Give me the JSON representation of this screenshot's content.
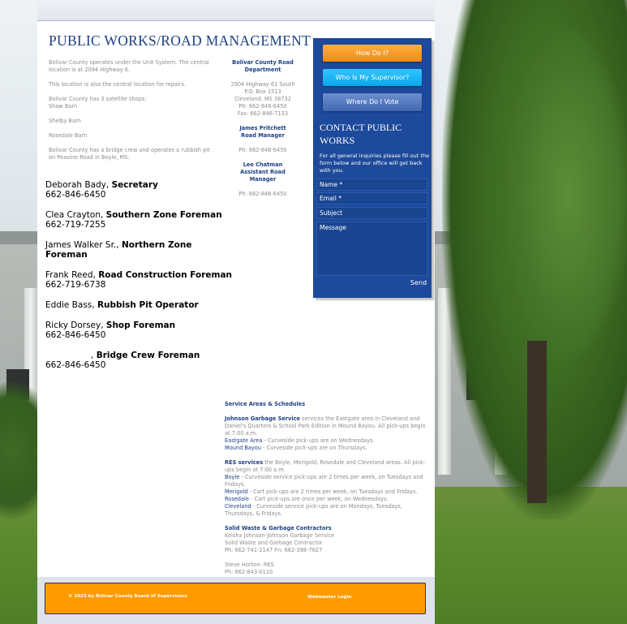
{
  "page": {
    "title": "PUBLIC WORKS/ROAD MANAGEMENT"
  },
  "intro": {
    "p1": "Bolivar County operates under the Unit System.  The central location is at 2094 Highway 6.",
    "p2": "This location is also the central location for repairs.",
    "p3a": "Bolivar County has 3 satellite shops:",
    "p3b": "Shaw Barn",
    "p4": "Shelby Barn",
    "p5": "Rosedale Barn",
    "p6": "Bolivar County has a bridge crew and operates a rubbish pit on Peavine Road in Boyle, MS."
  },
  "department": {
    "name_line1": "Bolivar County Road",
    "name_line2": "Department",
    "address1": "2904 Highway 61 South",
    "address2": "P.O. Box 1513",
    "address3": "Cleveland, MS  38732",
    "phone": "Ph:  662-846-6450",
    "fax": "Fax:  662-846-7133",
    "contacts": [
      {
        "name": "James Pritchett",
        "title": "Road Manager",
        "phone": "Ph:  662-846-6450"
      },
      {
        "name": "Lee Chatman",
        "title": "Assistant Road Manager",
        "phone": "Ph:  662-846-6450"
      }
    ]
  },
  "staff": [
    {
      "name": "Deborah Bady, ",
      "role": "Secretary",
      "phone": "662-846-6450"
    },
    {
      "name": "Clea Crayton, ",
      "role": "Southern Zone Foreman",
      "phone": "662-719-7255"
    },
    {
      "name": "James Walker Sr., ",
      "role": "Northern Zone Foreman",
      "phone": ""
    },
    {
      "name": "Frank Reed, ",
      "role": "Road Construction Foreman",
      "phone": "662-719-6738"
    },
    {
      "name": "Eddie Bass, ",
      "role": "Rubbish Pit Operator",
      "phone": ""
    },
    {
      "name": "Ricky Dorsey, ",
      "role": "Shop Foreman",
      "phone": "662-846-6450"
    },
    {
      "name": ", ",
      "role": "Bridge Crew Foreman",
      "phone": "662-846-6450"
    }
  ],
  "sidebar": {
    "btn_howdoi": "How Do I?",
    "btn_supervisor": "Who Is My Supervisor?",
    "btn_vote": "Where Do I Vote",
    "contact_title": "CONTACT PUBLIC WORKS",
    "contact_note": "For all general inquiries please fill out the form below and our office will get back with you.",
    "name_placeholder": "Name *",
    "email_placeholder": "Email *",
    "subject_placeholder": "Subject",
    "message_placeholder": "Message",
    "send_label": "Send"
  },
  "service": {
    "heading": "Service Areas & Schedules",
    "johnson_name": "Johnson Garbage Service",
    "johnson_text": " services the Eastgate area in Cleveland and Daniel's Quarters & School Park Edition in Mound Bayou. All pick-ups begin at 7:00 a.m.",
    "eastgate_label": "Eastgate Area",
    "eastgate_text": " - Curveside pick-ups are on Wednesdays.",
    "mound_label": "Mound Bayou",
    "mound_text": " - Curveside pick-ups are on Thursdays.",
    "res_name": "RES services",
    "res_text": " the Boyle, Merigold, Rosedale and Cleveland areas. All pick-ups begin at 7:00 a.m.",
    "boyle_label": "Boyle",
    "boyle_text": " - Curveside service pick-ups are 2 times per week, on Tuesdays and Fridays.",
    "merigold_label": "Merigold",
    "merigold_text": " - Cart pick-ups are 2 times per week, on Tuesdays and Fridays.",
    "rosedale_label": "Rosedale",
    "rosedale_text": " - Cart pick-ups are once per week, on Wednesdays.",
    "cleveland_label": "Cleveland",
    "cleveland_text": " - Curveside service pick-ups are on Mondays, Tuesdays, Thursdays, & Fridays.",
    "contractors_heading": "Solid Waste & Garbage Contractors",
    "c1_line1": "Keisha Johnson-Johnson Garbage Service",
    "c1_line2": "Solid Waste and Garbage Contractor",
    "c1_line3": "Ph: 662-741-2147 Fn: 662-398-7627",
    "c2_line1": "Steve Horton- RES",
    "c2_line2": "Ph: 662-843-0110"
  },
  "footer": {
    "copyright": "© 2023 by Bolivar County Board of Supervisors",
    "webmaster": "Webmaster Login"
  },
  "colors": {
    "title_blue": "#1d3f86",
    "sidebar_blue": "#1d4a9a",
    "footer_orange": "#ff9a00"
  }
}
